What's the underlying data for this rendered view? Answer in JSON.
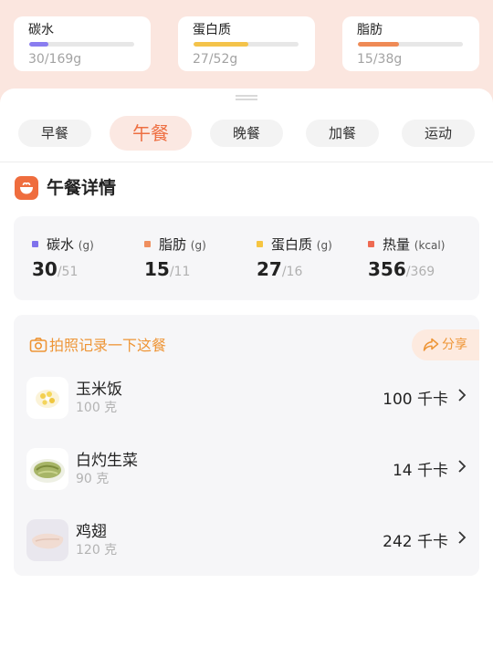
{
  "summary": {
    "carbs": {
      "name": "碳水",
      "value": "30/169g",
      "progress": 0.18,
      "color": "#8a7df0"
    },
    "protein": {
      "name": "蛋白质",
      "value": "27/52g",
      "progress": 0.52,
      "color": "#f4c34a"
    },
    "fat": {
      "name": "脂肪",
      "value": "15/38g",
      "progress": 0.39,
      "color": "#ef8a55"
    }
  },
  "tabs": [
    "早餐",
    "午餐",
    "晚餐",
    "加餐",
    "运动"
  ],
  "active_tab": 1,
  "detail": {
    "title": "午餐详情",
    "nutrients": [
      {
        "label": "碳水",
        "unit": "(g)",
        "current": "30",
        "target": "/51",
        "color": "#7f72ec"
      },
      {
        "label": "脂肪",
        "unit": "(g)",
        "current": "15",
        "target": "/11",
        "color": "#ef8f5f"
      },
      {
        "label": "蛋白质",
        "unit": "(g)",
        "current": "27",
        "target": "/16",
        "color": "#f6c541"
      },
      {
        "label": "热量",
        "unit": "(kcal)",
        "current": "356",
        "target": "/369",
        "color": "#ee6a52"
      }
    ]
  },
  "photo_prompt": "拍照记录一下这餐",
  "share_label": "分享",
  "icons": {
    "meal": "meal-bowl-icon",
    "camera": "camera-icon",
    "share": "share-icon",
    "chevron": "chevron-right-icon"
  },
  "foods": [
    {
      "name": "玉米饭",
      "amount": "100 克",
      "kcal": "100 千卡"
    },
    {
      "name": "白灼生菜",
      "amount": "90 克",
      "kcal": "14 千卡"
    },
    {
      "name": "鸡翅",
      "amount": "120 克",
      "kcal": "242 千卡"
    }
  ]
}
